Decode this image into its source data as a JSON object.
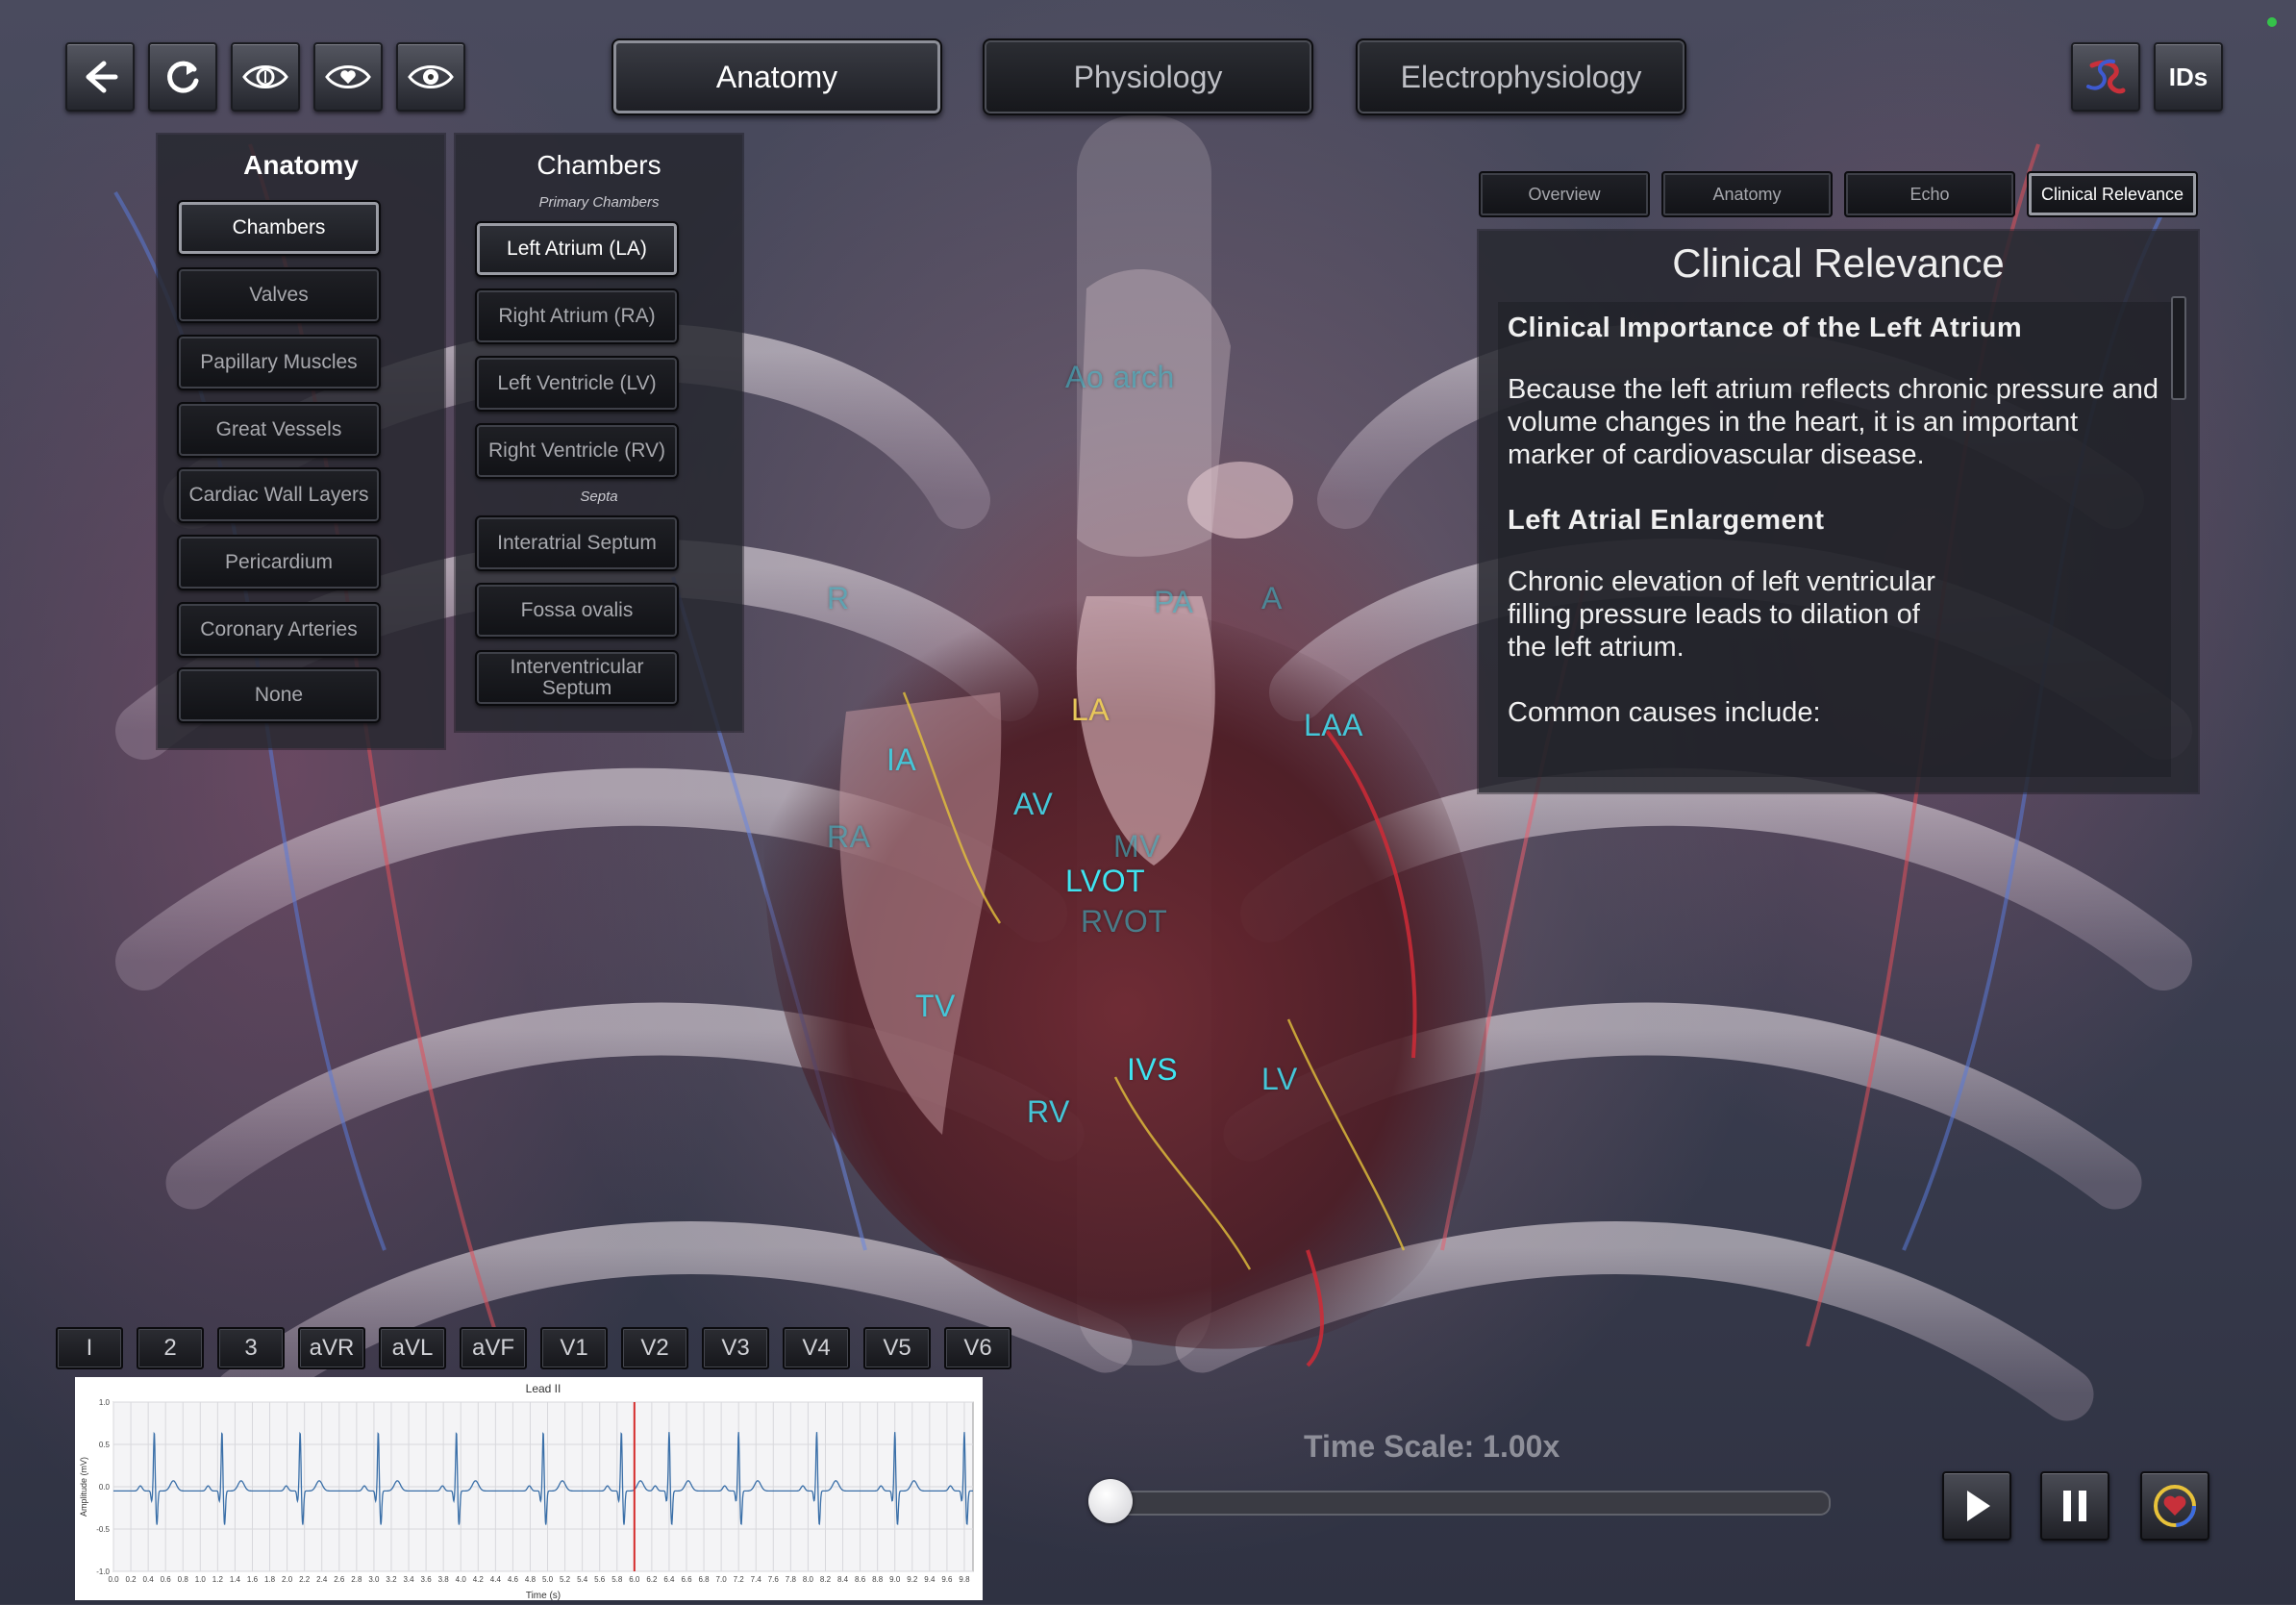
{
  "toolbar": {
    "icons": [
      "back-arrow-icon",
      "refresh-icon",
      "eye-outline-icon",
      "eye-heart-icon",
      "eye-icon"
    ]
  },
  "main_tabs": [
    {
      "label": "Anatomy",
      "active": true
    },
    {
      "label": "Physiology",
      "active": false
    },
    {
      "label": "Electrophysiology",
      "active": false
    }
  ],
  "top_right": {
    "logo_icon": "heart-logo-icon",
    "ids_label": "IDs"
  },
  "anatomy_panel": {
    "title": "Anatomy",
    "items": [
      "Chambers",
      "Valves",
      "Papillary Muscles",
      "Great Vessels",
      "Cardiac Wall Layers",
      "Pericardium",
      "Coronary Arteries",
      "None"
    ],
    "selected": "Chambers"
  },
  "chambers_panel": {
    "title": "Chambers",
    "primary_heading": "Primary Chambers",
    "primary_items": [
      "Left Atrium (LA)",
      "Right Atrium (RA)",
      "Left Ventricle (LV)",
      "Right Ventricle (RV)"
    ],
    "septa_heading": "Septa",
    "septa_items": [
      "Interatrial Septum",
      "Fossa ovalis",
      "Interventricular Septum"
    ],
    "selected": "Left Atrium (LA)"
  },
  "info_tabs": [
    {
      "label": "Overview",
      "active": false
    },
    {
      "label": "Anatomy",
      "active": false
    },
    {
      "label": "Echo",
      "active": false
    },
    {
      "label": "Clinical Relevance",
      "active": true
    }
  ],
  "info": {
    "title": "Clinical Relevance",
    "heading1": "Clinical Importance of the Left Atrium",
    "para1": "Because the left atrium reflects chronic pressure and volume changes in the heart, it is an important marker of cardiovascular disease.",
    "heading2": "Left Atrial Enlargement",
    "para2": "Chronic elevation of left ventricular filling pressure leads to dilation of the left atrium.",
    "para3": "Common causes include:"
  },
  "heart_labels": {
    "ao_arch": "Ao arch",
    "pa": "PA",
    "la": "LA",
    "laa": "LAA",
    "ia": "IA",
    "av": "AV",
    "ra": "RA",
    "mv": "MV",
    "lvot": "LVOT",
    "rvot": "RVOT",
    "tv": "TV",
    "ivs": "IVS",
    "lv": "LV",
    "rv": "RV",
    "partial_left": "R",
    "partial_right": "A"
  },
  "leads": [
    "I",
    "2",
    "3",
    "aVR",
    "aVL",
    "aVF",
    "V1",
    "V2",
    "V3",
    "V4",
    "V5",
    "V6"
  ],
  "chart_data": {
    "type": "line",
    "title": "Lead II",
    "xlabel": "Time (s)",
    "ylabel": "Amplitude (mV)",
    "xlim": [
      0.0,
      9.9
    ],
    "ylim": [
      -1.0,
      1.0
    ],
    "x_ticks": [
      "0.0",
      "0.2",
      "0.4",
      "0.6",
      "0.8",
      "1.0",
      "1.2",
      "1.4",
      "1.6",
      "1.8",
      "2.0",
      "2.2",
      "2.4",
      "2.6",
      "2.8",
      "3.0",
      "3.2",
      "3.4",
      "3.6",
      "3.8",
      "4.0",
      "4.2",
      "4.4",
      "4.6",
      "4.8",
      "5.0",
      "5.2",
      "5.4",
      "5.6",
      "5.8",
      "6.0",
      "6.2",
      "6.4",
      "6.6",
      "6.8",
      "7.0",
      "7.2",
      "7.4",
      "7.6",
      "7.8",
      "8.0",
      "8.2",
      "8.4",
      "8.6",
      "8.8",
      "9.0",
      "9.2",
      "9.4",
      "9.6",
      "9.8"
    ],
    "y_ticks": [
      "1.0",
      "0.5",
      "0.0",
      "-0.5",
      "-1.0"
    ],
    "r_peak_times": [
      0.47,
      1.25,
      2.15,
      3.05,
      3.95,
      4.95,
      5.85,
      6.4,
      7.2,
      8.1,
      9.0,
      9.8
    ],
    "r_peak_amp": 0.7,
    "s_amp": -0.4,
    "cursor_time": 6.0,
    "grid": true,
    "series": [
      {
        "color": "#3a6fa8"
      }
    ],
    "cursor_color": "#d42a2a"
  },
  "time_scale": {
    "label": "Time Scale: 1.00x",
    "value": 0.0
  },
  "playback": {
    "icons": [
      "play-icon",
      "pause-icon",
      "heart-cycle-icon"
    ]
  }
}
